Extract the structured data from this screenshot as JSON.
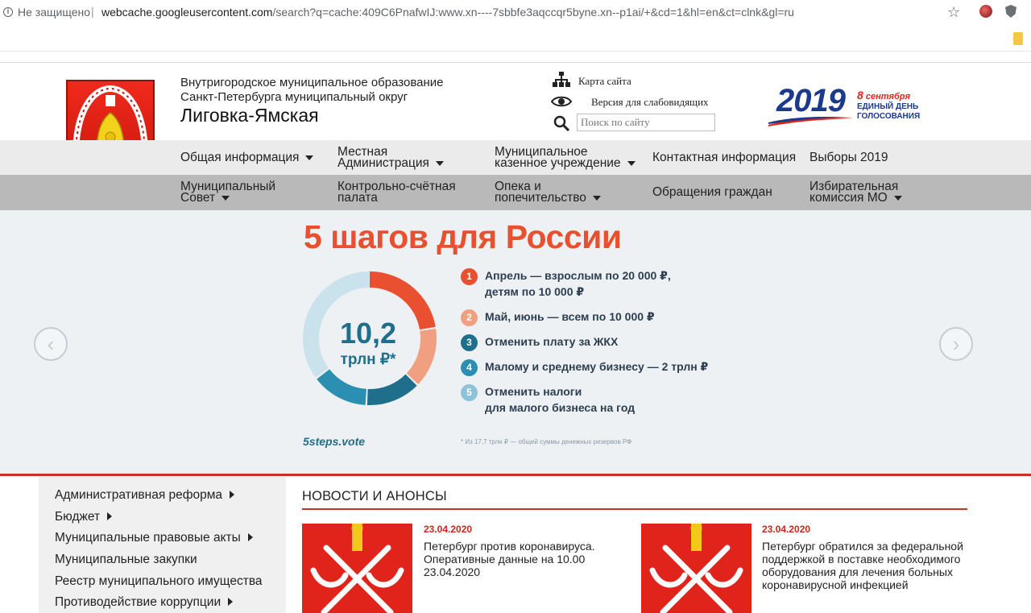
{
  "browser": {
    "secure_label": "Не защищено",
    "separator": "|",
    "url_host": "webcache.googleusercontent.com",
    "url_rest": "/search?q=cache:409C6PnafwIJ:www.xn----7sbbfe3aqccqr5byne.xn--p1ai/+&cd=1&hl=en&ct=clnk&gl=ru",
    "star_glyph": "☆"
  },
  "header": {
    "org_line1": "Внутригородское муниципальное образование",
    "org_line2": "Санкт-Петербурга муниципальный округ",
    "org_name": "Лиговка-Ямская",
    "sitemap_label": "Карта сайта",
    "vision_label": "Версия для слабовидящих",
    "search_placeholder": "Поиск по сайту",
    "election": {
      "year": "2019",
      "date_num": "8",
      "date_month": "сентября",
      "line1": "ЕДИНЫЙ ДЕНЬ",
      "line2": "ГОЛОСОВАНИЯ"
    }
  },
  "nav": {
    "row1": [
      {
        "line1": "Общая информация",
        "line2": "",
        "caret": true
      },
      {
        "line1": "Местная",
        "line2": "Администрация",
        "caret": true
      },
      {
        "line1": "Муниципальное",
        "line2": "казенное учреждение",
        "caret": true
      },
      {
        "line1": "Контактная информация",
        "line2": "",
        "caret": false
      },
      {
        "line1": "Выборы 2019",
        "line2": "",
        "caret": false
      }
    ],
    "row2": [
      {
        "line1": "Муниципальный",
        "line2": "Совет",
        "caret": true
      },
      {
        "line1": "Контрольно-счётная",
        "line2": "палата",
        "caret": false
      },
      {
        "line1": "Опека и",
        "line2": "попечительство",
        "caret": true
      },
      {
        "line1": "Обращения граждан",
        "line2": "",
        "caret": false
      },
      {
        "line1": "Избирательная",
        "line2": "комиссия МО",
        "caret": true
      }
    ]
  },
  "banner": {
    "title": "5 шагов для России",
    "donut_value": "10,2",
    "donut_unit": "трлн ₽*",
    "steps": [
      {
        "num": "1",
        "text1": "Апрель — взрослым по 20 000 ₽,",
        "text2": "детям по 10 000 ₽",
        "color": "#e8502f"
      },
      {
        "num": "2",
        "text1": "Май, июнь — всем по 10 000 ₽",
        "text2": "",
        "color": "#f0a081"
      },
      {
        "num": "3",
        "text1": "Отменить плату за ЖКХ",
        "text2": "",
        "color": "#1f6e8c"
      },
      {
        "num": "4",
        "text1": "Малому и среднему бизнесу — 2 трлн ₽",
        "text2": "",
        "color": "#2a8fb0"
      },
      {
        "num": "5",
        "text1": "Отменить налоги",
        "text2": "для малого бизнеса на год",
        "color": "#8cc3d8"
      }
    ],
    "site": "5steps.vote",
    "note": "* Из 17,7 трлн ₽ — общей суммы денежных резервов РФ",
    "prev_glyph": "‹",
    "next_glyph": "›"
  },
  "sidebar": {
    "items": [
      {
        "label": "Административная реформа",
        "arrow": true
      },
      {
        "label": "Бюджет",
        "arrow": true
      },
      {
        "label": "Муниципальные правовые акты",
        "arrow": true
      },
      {
        "label": "Муниципальные закупки",
        "arrow": false
      },
      {
        "label": "Реестр муниципального имущества",
        "arrow": false
      },
      {
        "label": "Противодействие коррупции",
        "arrow": true
      }
    ]
  },
  "news": {
    "heading": "НОВОСТИ И АНОНСЫ",
    "items": [
      {
        "date": "23.04.2020",
        "text": "Петербург против коронавируса. Оперативные данные на 10.00 23.04.2020"
      },
      {
        "date": "23.04.2020",
        "text": "Петербург обратился за федеральной поддержкой в поставке необходимого оборудования для лечения больных коронавирусной инфекцией"
      }
    ]
  },
  "colors": {
    "accent_red": "#c9302c",
    "banner_orange": "#e8502f",
    "banner_blue": "#1f6e8c",
    "nav_row1_bg": "#ebebeb",
    "nav_row2_bg": "#b9b9b9"
  }
}
